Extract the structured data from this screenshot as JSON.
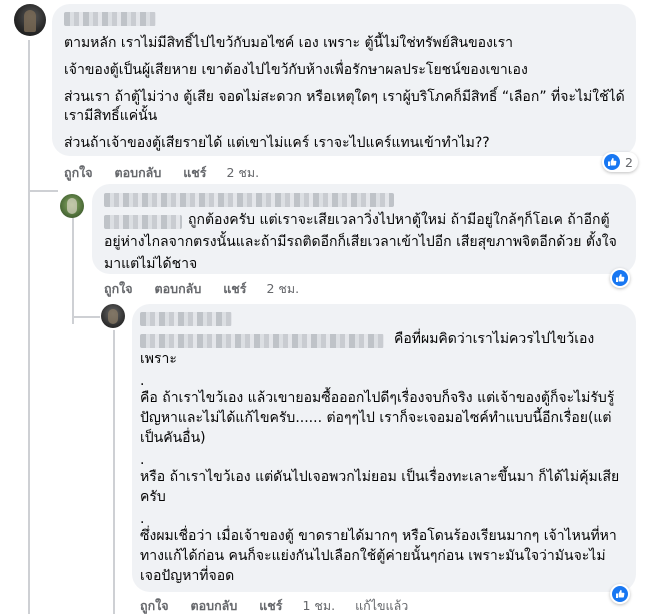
{
  "colors": {
    "accent": "#1877f2",
    "bubble": "#f0f2f5",
    "meta_text": "#65676b"
  },
  "comments": [
    {
      "lines": [
        "ตามหลัก เราไม่มีสิทธิ์ไปไขว้กับมอไซค์ เอง เพราะ ตู้นี้ไม่ใช่ทรัพย์สินของเรา",
        "เจ้าของตู้เป็นผู้เสียหาย เขาต้องไปไขว้กับห้างเพื่อรักษาผลประโยชน์ของเขาเอง",
        "ส่วนเรา ถ้าตู้ไม่ว่าง ตู้เสีย จอดไม่สะดวก หรือเหตุใดๆ เราผู้บริโภคก็มีสิทธิ์ “เลือก” ที่จะไม่ใช้ได้",
        "เรามีสิทธิ์แค่นั้น",
        "ส่วนถ้าเจ้าของตู้เสียรายได้ แต่เขาไม่แคร์ เราจะไปแคร์แทนเข้าทำไม??"
      ],
      "actions": {
        "like": "ถูกใจ",
        "reply": "ตอบกลับ",
        "share": "แชร์",
        "time": "2 ชม."
      },
      "reaction": {
        "icon": "like-icon",
        "count": "2"
      }
    },
    {
      "lines": [
        "ถูกต้องครับ แต่เราจะเสียเวลาวิ่งไปหาตู้ใหม่ ถ้ามีอยู่ใกล้ๆก็โอเค ถ้าอีกตู้",
        "อยู่ห่างไกลจากตรงนั้นและถ้ามีรถติดอีกก็เสียเวลาเข้าไปอีก เสียสุขภาพจิตอีกด้วย ตั้งใจ",
        "มาแต่ไม่ได้ชาจ"
      ],
      "actions": {
        "like": "ถูกใจ",
        "reply": "ตอบกลับ",
        "share": "แชร์",
        "time": "2 ชม."
      },
      "reaction": {
        "icon": "like-icon"
      }
    },
    {
      "lines": [
        "คือที่ผมคิดว่าเราไม่ควรไปไขว้เอง",
        "เพราะ",
        ".",
        "คือ ถ้าเราไขว้เอง แล้วเขายอมซื้อออกไปดีๆเรื่องจบก็จริง แต่เจ้าของตู้ก็จะไม่รับรู้",
        "ปัญหาและไม่ได้แก้ไขครับ...... ต่อๆๆไป เราก็จะเจอมอไซค์ทำแบบนี้อีกเรื่อย(แต่",
        "เป็นคันอื่น)",
        ".",
        "หรือ ถ้าเราไขว้เอง แต่ดันไปเจอพวกไม่ยอม เป็นเรื่องทะเลาะขึ้นมา ก็ได้ไม่คุ้มเสีย",
        "ครับ",
        ".",
        "ซึ่งผมเชื่อว่า เมื่อเจ้าของตู้ ขาดรายได้มากๆ หรือโดนร้องเรียนมากๆ เจ้าไหนที่หา",
        "ทางแก้ได้ก่อน คนก็จะแย่งกันไปเลือกใช้ตู้ค่ายนั้นๆก่อน เพราะมันใจว่ามันจะไม่",
        "เจอปัญหาที่จอด"
      ],
      "actions": {
        "like": "ถูกใจ",
        "reply": "ตอบกลับ",
        "share": "แชร์",
        "time": "1 ชม.",
        "edited": "แก้ไขแล้ว"
      },
      "reaction": {
        "icon": "like-icon"
      }
    }
  ]
}
